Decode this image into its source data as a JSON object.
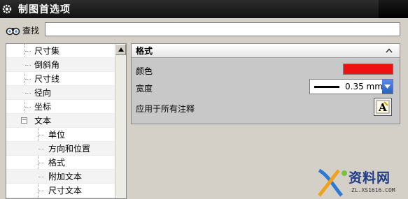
{
  "window": {
    "title": "制图首选项"
  },
  "search": {
    "label": "查找",
    "value": "",
    "placeholder": ""
  },
  "tree": {
    "items": [
      {
        "label": "尺寸集",
        "level": 1
      },
      {
        "label": "倒斜角",
        "level": 1
      },
      {
        "label": "尺寸线",
        "level": 1
      },
      {
        "label": "径向",
        "level": 1
      },
      {
        "label": "坐标",
        "level": 1
      },
      {
        "label": "文本",
        "level": 1,
        "expanded": true
      },
      {
        "label": "单位",
        "level": 2
      },
      {
        "label": "方向和位置",
        "level": 2
      },
      {
        "label": "格式",
        "level": 2
      },
      {
        "label": "附加文本",
        "level": 2
      },
      {
        "label": "尺寸文本",
        "level": 2
      }
    ]
  },
  "format_panel": {
    "header": "格式",
    "color_label": "颜色",
    "color_value": "#ee1111",
    "width_label": "宽度",
    "width_value": "0.35 mm",
    "apply_label": "应用于所有注释",
    "apply_icon_letter": "A"
  },
  "watermark": {
    "main": "资料网",
    "sub": "ZL.XS1616.COM"
  }
}
